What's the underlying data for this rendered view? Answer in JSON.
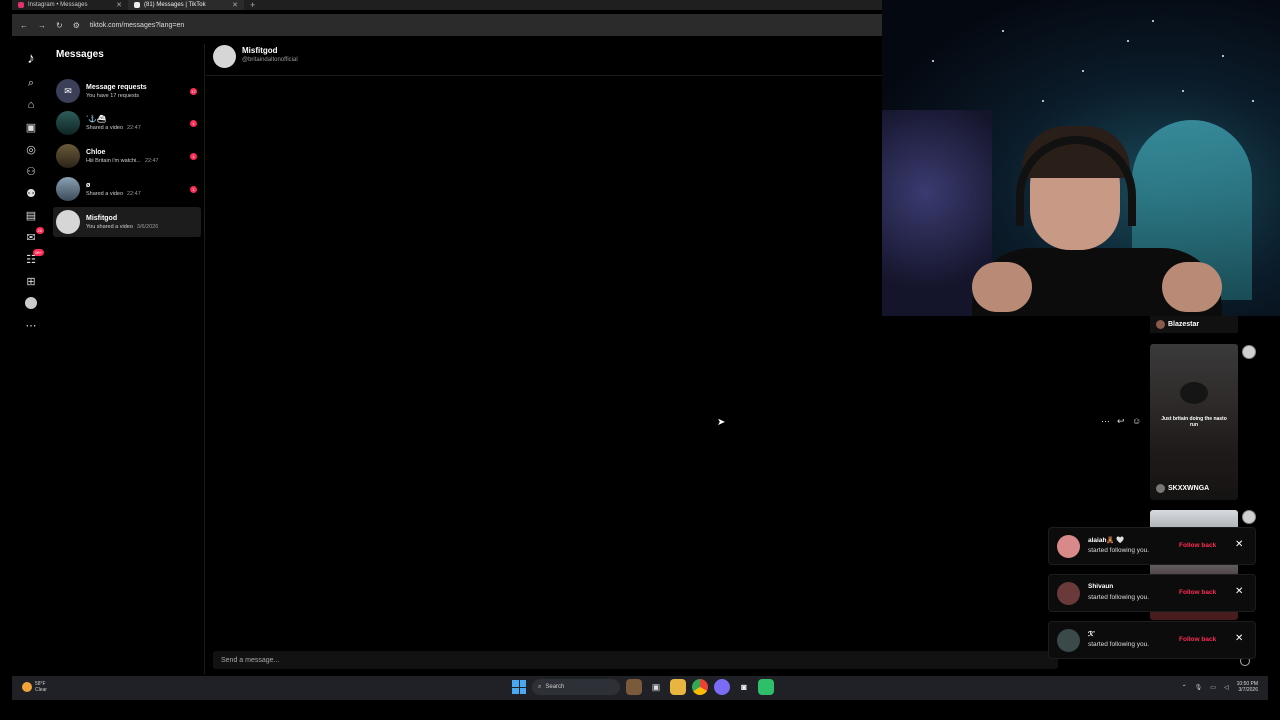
{
  "browser": {
    "tabs": [
      {
        "label": "Instagram • Messages",
        "color": "#e1306c"
      },
      {
        "label": "(81) Messages | TikTok",
        "color": "#ffffff"
      }
    ],
    "new_tab": "+",
    "url": "tiktok.com/messages?lang=en"
  },
  "rail": {
    "badge_1": "20",
    "badge_2": "99+"
  },
  "messages": {
    "title": "Messages",
    "conversations": [
      {
        "name": "Message requests",
        "preview": "You have 17 requests",
        "time": "",
        "badge": "17"
      },
      {
        "name": "˙⚓⛴",
        "preview": "Shared a video",
        "time": "22:47",
        "badge": "1"
      },
      {
        "name": "Chloe",
        "preview": "Hiii Britain i'm watchi...",
        "time": "22:47",
        "badge": "1"
      },
      {
        "name": "ø",
        "preview": "Shared a video",
        "time": "22:47",
        "badge": "1"
      },
      {
        "name": "Misfitgod",
        "preview": "You shared a video",
        "time": "3/6/2026",
        "badge": ""
      }
    ]
  },
  "chat": {
    "name": "Misfitgod",
    "handle": "@britaindaltonofficial",
    "composer_placeholder": "Send a message..."
  },
  "feed": {
    "top_user": "Blazestar",
    "caption": "Just britain doing the nasto run",
    "video_user": "SKXXWNGA"
  },
  "notifications": [
    {
      "name": "alaiah🧸 🤍",
      "action": "started following you.",
      "button": "Follow back",
      "color": "#d88a8a"
    },
    {
      "name": "Shivaun",
      "action": "started following you.",
      "button": "Follow back",
      "color": "#6a3a3a"
    },
    {
      "name": "ℛ˚",
      "action": "started following you.",
      "button": "Follow back",
      "color": "#3a4a4a"
    }
  ],
  "taskbar": {
    "weather_temp": "58°F",
    "weather_desc": "Clear",
    "search": "Search",
    "time": "10:50 PM",
    "date": "3/7/2026"
  }
}
